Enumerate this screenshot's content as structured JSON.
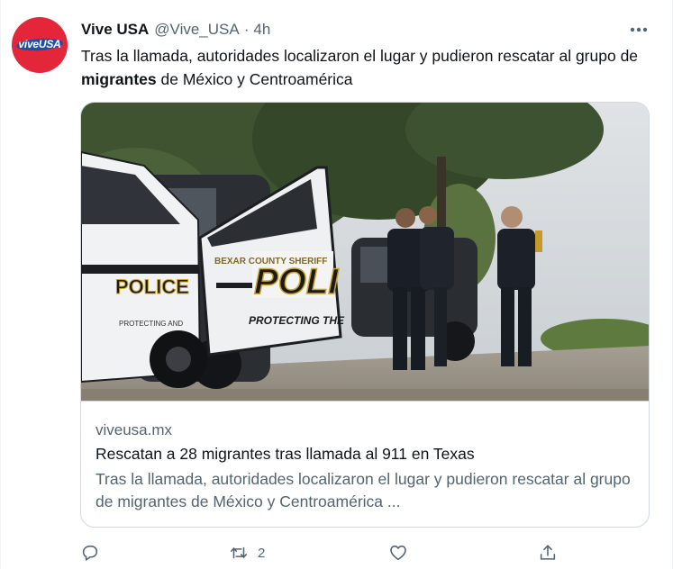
{
  "account": {
    "avatar_text": "viveUSA",
    "name": "Vive USA",
    "handle": "@Vive_USA",
    "separator": "·",
    "time": "4h"
  },
  "tweet": {
    "text_before": "Tras la llamada, autoridades localizaron el lugar y pudieron rescatar al grupo de ",
    "text_bold": "migrantes",
    "text_after": " de México y Centroamérica"
  },
  "card": {
    "image_texts": {
      "car1": "POLICE",
      "car1_small": "PROTECTING AND",
      "door_top": "BEXAR COUNTY SHERIFF",
      "door_big": "POLI",
      "door_bottom": "PROTECTING THE"
    },
    "domain": "viveusa.mx",
    "title": "Rescatan a 28 migrantes tras llamada al 911 en Texas",
    "description": "Tras la llamada, autoridades localizaron el lugar y pudieron rescatar al grupo de migrantes de México y Centroamérica ..."
  },
  "actions": {
    "reply_icon": "reply-icon",
    "retweet_icon": "retweet-icon",
    "retweet_count": "2",
    "like_icon": "heart-icon",
    "share_icon": "share-icon"
  },
  "colors": {
    "secondary_text": "#536471",
    "primary_text": "#0f1419",
    "border": "#cfd9de",
    "avatar_red": "#e3263a",
    "avatar_blue": "#1e4fa8"
  }
}
